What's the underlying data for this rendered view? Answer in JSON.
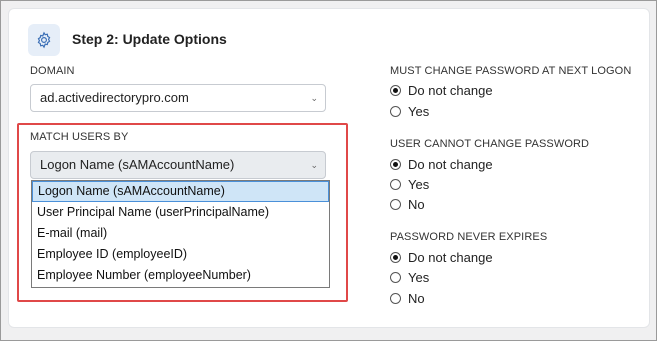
{
  "step": {
    "icon": "gear-icon",
    "title": "Step 2: Update Options"
  },
  "domain": {
    "label": "DOMAIN",
    "value": "ad.activedirectorypro.com"
  },
  "match_users_by": {
    "label": "MATCH USERS BY",
    "value": "Logon Name (sAMAccountName)",
    "options": [
      "Logon Name (sAMAccountName)",
      "User Principal Name (userPrincipalName)",
      "E-mail (mail)",
      "Employee ID (employeeID)",
      "Employee Number (employeeNumber)"
    ],
    "selected_index": 0
  },
  "must_change_password": {
    "label": "MUST CHANGE PASSWORD AT NEXT LOGON",
    "options": [
      "Do not change",
      "Yes"
    ],
    "selected": "Do not change"
  },
  "user_cannot_change_password": {
    "label": "USER CANNOT CHANGE PASSWORD",
    "options": [
      "Do not change",
      "Yes",
      "No"
    ],
    "selected": "Do not change"
  },
  "password_never_expires": {
    "label": "PASSWORD NEVER EXPIRES",
    "options": [
      "Do not change",
      "Yes",
      "No"
    ],
    "selected": "Do not change"
  },
  "colors": {
    "highlight_border": "#e04848",
    "selected_option_bg": "#cfe5f7",
    "icon_bg": "#e6eef8",
    "icon_color": "#3b6fb6"
  }
}
